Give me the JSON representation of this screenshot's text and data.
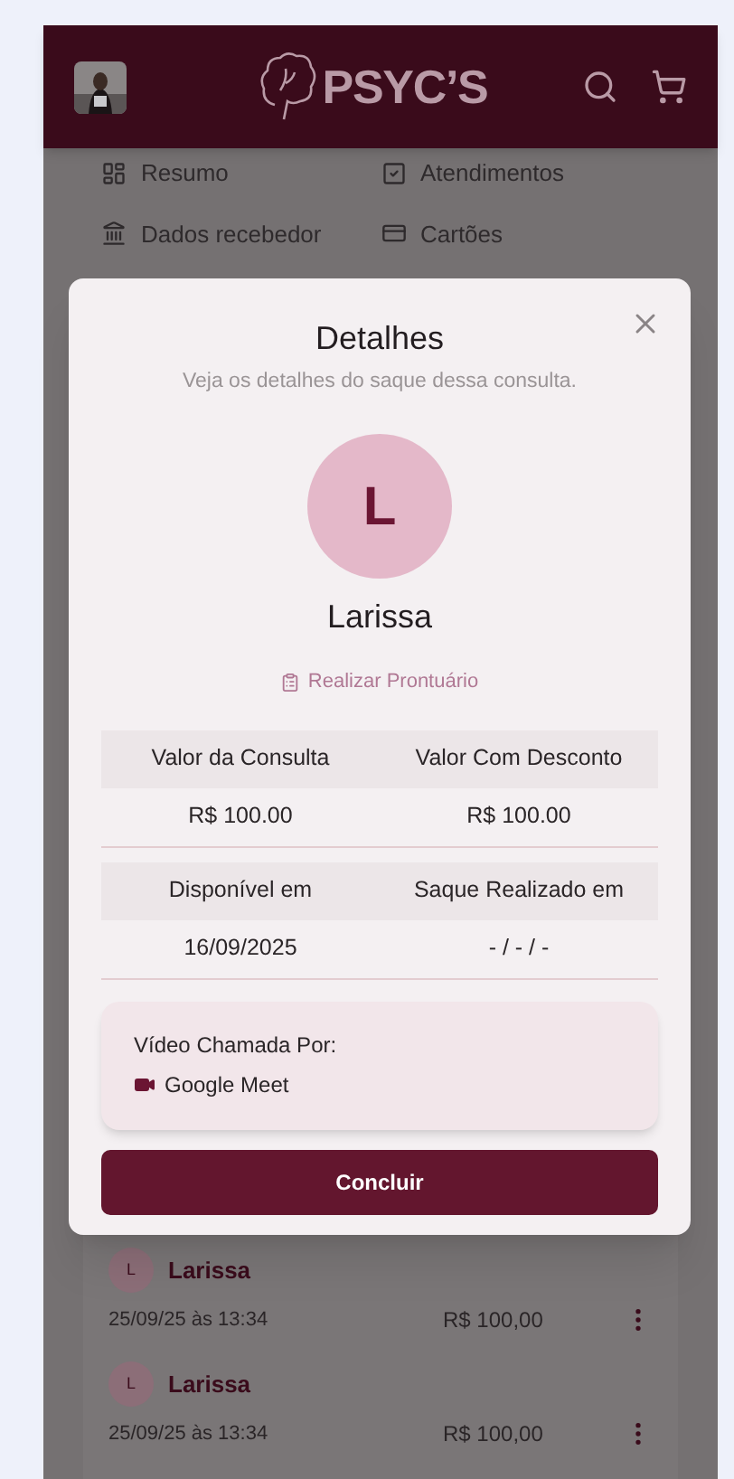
{
  "header": {
    "logo": "PSYC’S"
  },
  "menu": [
    {
      "label": "Resumo"
    },
    {
      "label": "Atendimentos"
    },
    {
      "label": "Dados recebedor"
    },
    {
      "label": "Cartões"
    }
  ],
  "modal": {
    "title": "Detalhes",
    "subtitle": "Veja os detalhes do saque dessa consulta.",
    "avatar_letter": "L",
    "name": "Larissa",
    "link": "Realizar Prontuário",
    "tables": [
      {
        "columns": [
          "Valor da Consulta",
          "Valor Com Desconto"
        ],
        "values": [
          "R$ 100.00",
          "R$ 100.00"
        ]
      },
      {
        "columns": [
          "Disponível em",
          "Saque Realizado em"
        ],
        "values": [
          "16/09/2025",
          "- / - / -"
        ]
      }
    ],
    "call": {
      "label": "Vídeo Chamada Por:",
      "platform": "Google Meet"
    },
    "button": "Concluir"
  },
  "list": [
    {
      "avatar_letter": "L",
      "name": "Larissa",
      "date": "25/09/25 às 13:34",
      "amount": "R$ 100,00"
    },
    {
      "avatar_letter": "L",
      "name": "Larissa",
      "date": "25/09/25 às 13:34",
      "amount": "R$ 100,00"
    }
  ]
}
